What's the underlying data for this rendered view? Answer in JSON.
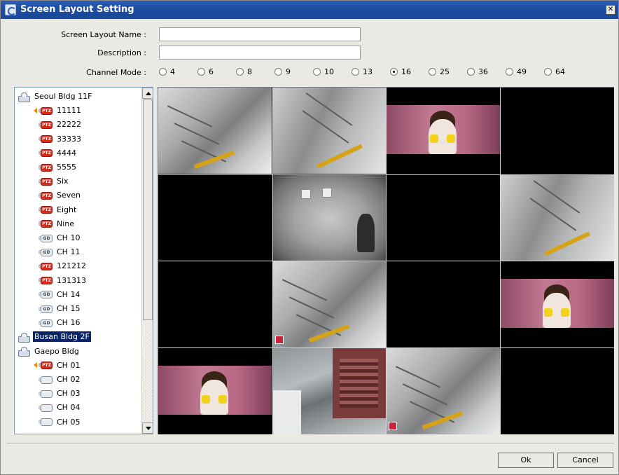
{
  "window": {
    "title": "Screen Layout Setting",
    "close_label": "✕"
  },
  "form": {
    "name_label": "Screen Layout Name :",
    "name_value": "",
    "description_label": "Description :",
    "description_value": "",
    "channel_mode_label": "Channel Mode :"
  },
  "channel_modes": {
    "selected": "16",
    "options": [
      "4",
      "6",
      "8",
      "9",
      "10",
      "13",
      "16",
      "25",
      "36",
      "49",
      "64"
    ]
  },
  "tree": {
    "items": [
      {
        "type": "building",
        "label": "Seoul Bldg 11F"
      },
      {
        "type": "ptz",
        "label": "11111",
        "active": true
      },
      {
        "type": "ptz",
        "label": "22222"
      },
      {
        "type": "ptz",
        "label": "33333"
      },
      {
        "type": "ptz",
        "label": "4444"
      },
      {
        "type": "ptz",
        "label": "5555"
      },
      {
        "type": "ptz",
        "label": "Six"
      },
      {
        "type": "ptz",
        "label": "Seven"
      },
      {
        "type": "ptz",
        "label": "Eight"
      },
      {
        "type": "ptz",
        "label": "Nine"
      },
      {
        "type": "cam",
        "label": "CH 10"
      },
      {
        "type": "cam",
        "label": "CH 11"
      },
      {
        "type": "ptz",
        "label": "121212"
      },
      {
        "type": "ptz",
        "label": "131313"
      },
      {
        "type": "cam",
        "label": "CH 14"
      },
      {
        "type": "cam",
        "label": "CH 15"
      },
      {
        "type": "cam",
        "label": "CH 16"
      },
      {
        "type": "building",
        "label": "Busan Bldg 2F",
        "selected": true
      },
      {
        "type": "building",
        "label": "Gaepo Bldg"
      },
      {
        "type": "ptz",
        "label": "CH 01",
        "active": true
      },
      {
        "type": "plain",
        "label": "CH 02"
      },
      {
        "type": "plain",
        "label": "CH 03"
      },
      {
        "type": "plain",
        "label": "CH 04"
      },
      {
        "type": "plain",
        "label": "CH 05"
      }
    ]
  },
  "icon_text": {
    "ptz": "PTZ",
    "cam": "GD"
  },
  "grid": {
    "cells": [
      "stair",
      "stair2",
      "tv",
      "empty",
      "empty",
      "elev",
      "empty",
      "stair2",
      "empty",
      "stair-rec",
      "empty",
      "tv",
      "tv",
      "street",
      "stair-rec",
      "empty"
    ]
  },
  "buttons": {
    "ok": "Ok",
    "cancel": "Cancel"
  }
}
